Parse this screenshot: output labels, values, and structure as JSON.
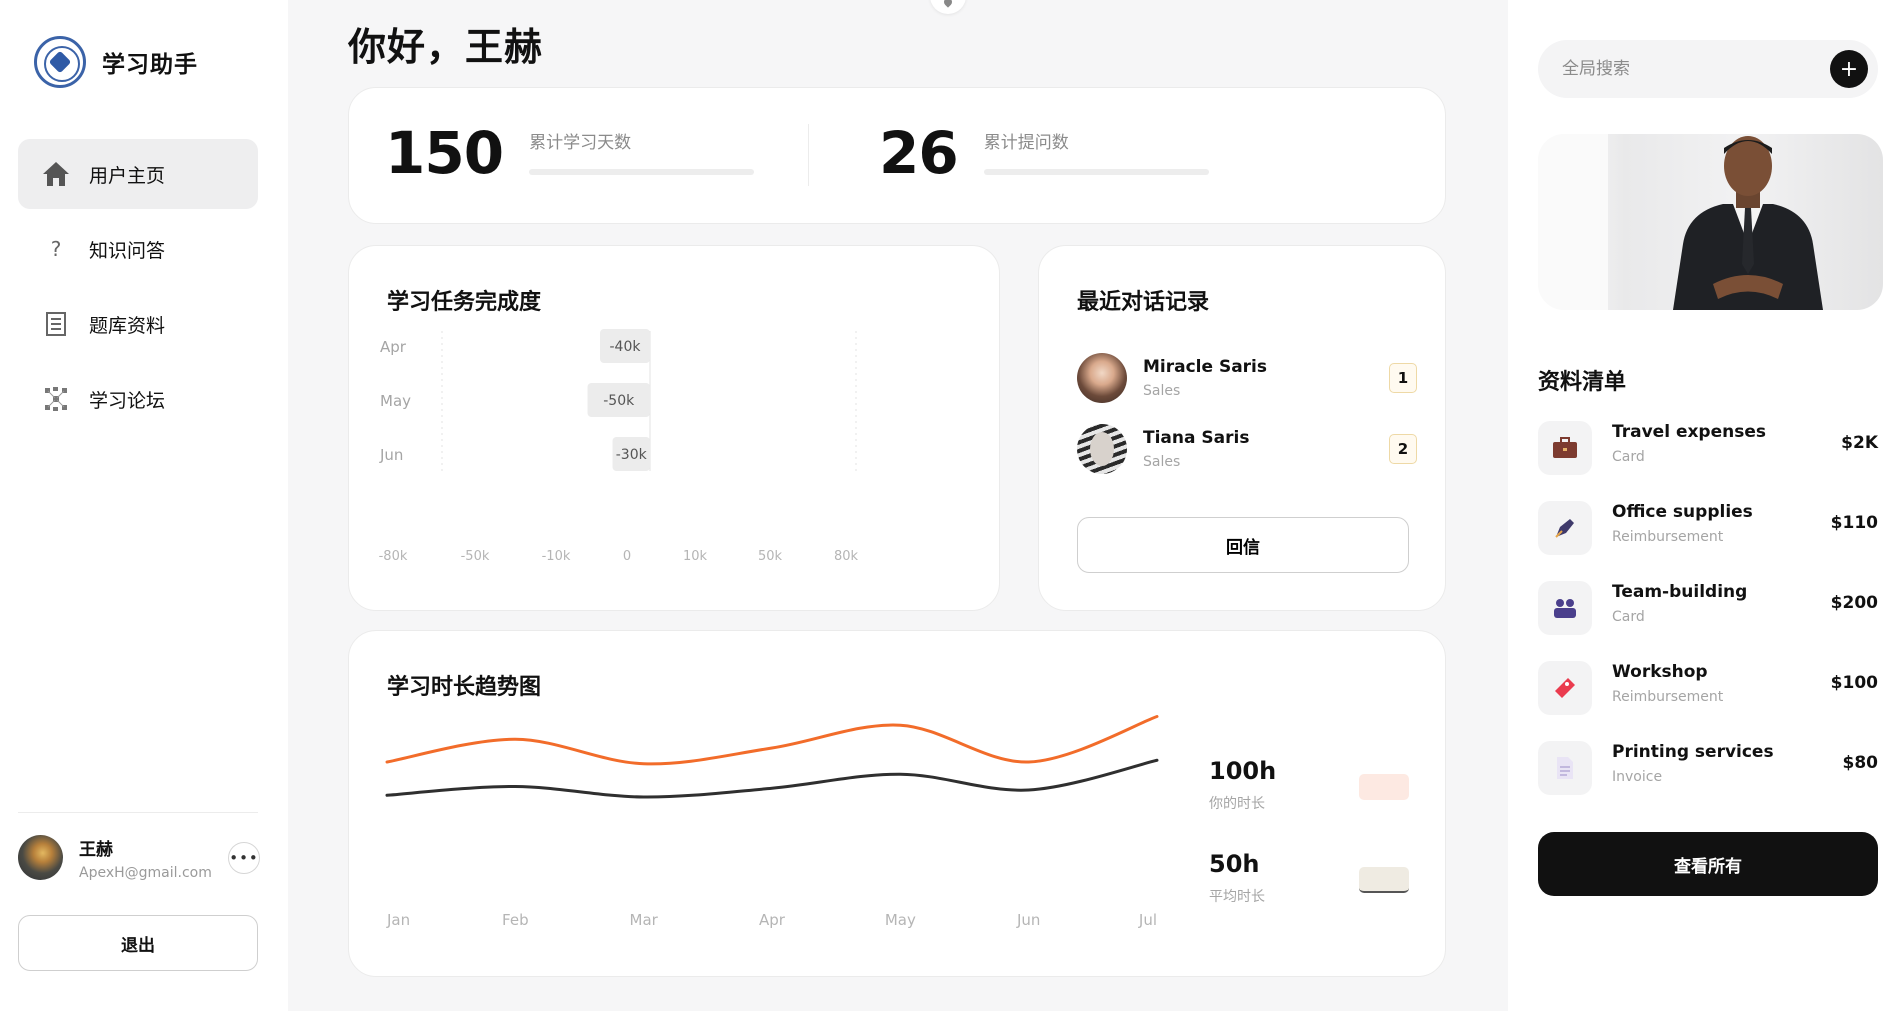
{
  "app": {
    "name": "学习助手"
  },
  "nav": {
    "items": [
      {
        "label": "用户主页",
        "icon": "home-icon",
        "active": true
      },
      {
        "label": "知识问答",
        "icon": "question-icon",
        "active": false
      },
      {
        "label": "题库资料",
        "icon": "document-icon",
        "active": false
      },
      {
        "label": "学习论坛",
        "icon": "network-icon",
        "active": false
      }
    ]
  },
  "user": {
    "name": "王赫",
    "email": "ApexH@gmail.com",
    "logout_label": "退出"
  },
  "greeting": "你好，王赫",
  "stats": {
    "days": {
      "value": "150",
      "label": "累计学习天数"
    },
    "questions": {
      "value": "26",
      "label": "累计提问数"
    }
  },
  "task_card": {
    "title": "学习任务完成度"
  },
  "dialog_card": {
    "title": "最近对话记录",
    "contacts": [
      {
        "name": "Miracle Saris",
        "role": "Sales",
        "badge": "1"
      },
      {
        "name": "Tiana Saris",
        "role": "Sales",
        "badge": "2"
      }
    ],
    "reply_label": "回信"
  },
  "trend_card": {
    "title": "学习时长趋势图",
    "legend": [
      {
        "value": "100h",
        "label": "你的时长",
        "color": "#fde9e2"
      },
      {
        "value": "50h",
        "label": "平均时长",
        "color": "#efebe2"
      }
    ]
  },
  "search": {
    "placeholder": "全局搜索"
  },
  "resources": {
    "title": "资料清单",
    "items": [
      {
        "name": "Travel expenses",
        "type": "Card",
        "amount": "$2K",
        "icon": "briefcase-icon"
      },
      {
        "name": "Office supplies",
        "type": "Reimbursement",
        "amount": "$110",
        "icon": "pen-icon"
      },
      {
        "name": "Team-building",
        "type": "Card",
        "amount": "$200",
        "icon": "team-icon"
      },
      {
        "name": "Workshop",
        "type": "Reimbursement",
        "amount": "$100",
        "icon": "ticket-icon"
      },
      {
        "name": "Printing services",
        "type": "Invoice",
        "amount": "$80",
        "icon": "file-icon"
      }
    ],
    "view_all_label": "查看所有"
  },
  "colors": {
    "accent_orange": "#f26c2a",
    "dark": "#2f2f2f",
    "button_dark": "#111111"
  },
  "chart_data": [
    {
      "type": "bar",
      "orientation": "horizontal",
      "categories": [
        "Apr",
        "May",
        "Jun"
      ],
      "values": [
        -40,
        -50,
        -30
      ],
      "data_labels": [
        "-40k",
        "-50k",
        "-30k"
      ],
      "xticks": [
        "-80k",
        "-50k",
        "-10k",
        "0",
        "10k",
        "50k",
        "80k"
      ]
    },
    {
      "type": "line",
      "x": [
        "Jan",
        "Feb",
        "Mar",
        "Apr",
        "May",
        "Jun",
        "Jul"
      ],
      "series": [
        {
          "name": "你的时长",
          "values": [
            72,
            85,
            71,
            80,
            93,
            72,
            98
          ],
          "color": "#f26c2a"
        },
        {
          "name": "平均时长",
          "values": [
            53,
            58,
            52,
            57,
            65,
            56,
            73
          ],
          "color": "#2f2f2f"
        }
      ],
      "grid": false
    }
  ]
}
